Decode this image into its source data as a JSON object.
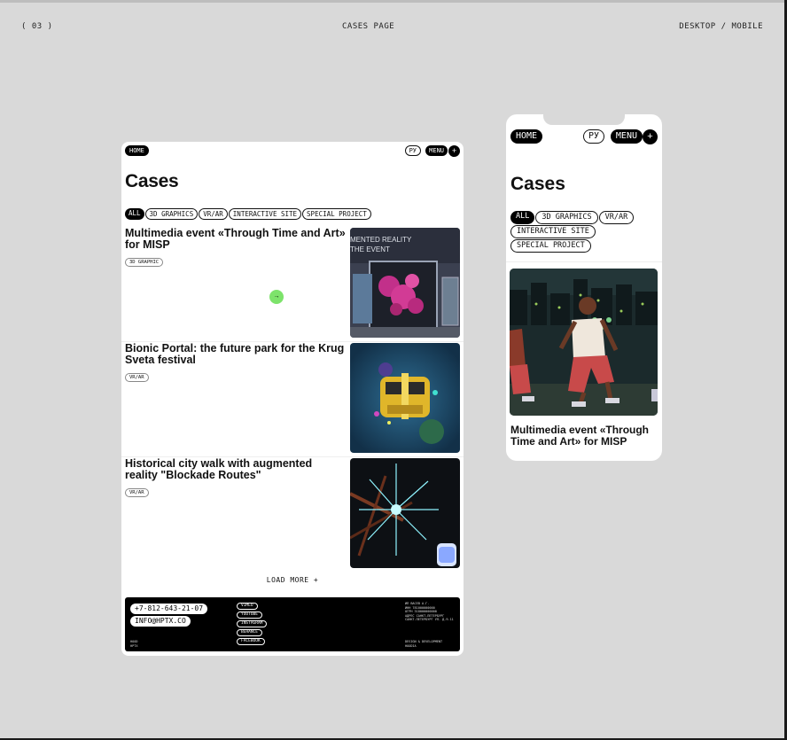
{
  "header": {
    "page_number": "( 03 )",
    "title": "CASES PAGE",
    "mode": "DESKTOP / MOBILE"
  },
  "desktop": {
    "nav": {
      "home": "HOME",
      "lang": "РУ",
      "menu": "MENU",
      "plus": "+"
    },
    "title": "Cases",
    "filters": [
      "ALL",
      "3D GRAPHICS",
      "VR/AR",
      "INTERACTIVE SITE",
      "SPECIAL PROJECT"
    ],
    "cases": [
      {
        "title": "Multimedia event «Through Time and Art» for MISP",
        "tag": "3D GRAPHIC",
        "image_text_1": "MENTED REALITY",
        "image_text_2": "THE EVENT"
      },
      {
        "title": "Bionic Portal: the future park for the Krug Sveta festival",
        "tag": "VR/AR"
      },
      {
        "title": "Historical city walk with augmented reality \"Blockade Routes\"",
        "tag": "VR/AR"
      }
    ],
    "cursor_icon": "→",
    "load_more": "LOAD MORE +",
    "footer": {
      "phone": "+7-812-643-21-07",
      "email": "INFO@HPTX.CO",
      "socials": [
        "VIMEO",
        "YOUTUBE",
        "INSTAGRAM",
        "BEHANCE",
        "FACEBOOK"
      ],
      "small_left": "HOOD\nHPTX",
      "small_right_top": "ИП ВАСЕВ А.Г.\nИНН 781000000000\nОГРН 318000000000\nАДРЕС САНКТ-ПЕТЕРБУРГ\nСАНКТ-ПЕТЕРБУРГ УЛ. Д.9-11",
      "small_right_bottom": "DESIGN & DEVELOPMENT\nHOODIA"
    }
  },
  "mobile": {
    "nav": {
      "home": "HOME",
      "lang": "РУ",
      "menu": "MENU",
      "plus": "+"
    },
    "title": "Cases",
    "filters": [
      "ALL",
      "3D GRAPHICS",
      "VR/AR",
      "INTERACTIVE SITE",
      "SPECIAL PROJECT"
    ],
    "case_title": "Multimedia event «Through Time and Art» for MISP"
  },
  "colors": {
    "background": "#d9d9d9",
    "cursor_green": "#7de36b",
    "dark": "#000000"
  }
}
